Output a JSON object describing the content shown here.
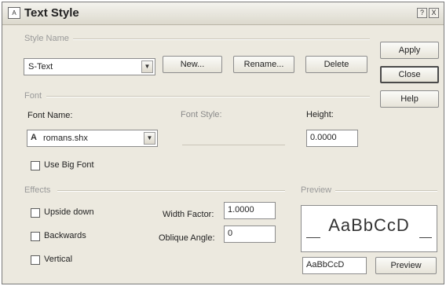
{
  "window": {
    "title": "Text Style",
    "help_glyph": "?",
    "close_glyph": "X"
  },
  "style_name": {
    "group_label": "Style Name",
    "selected": "S-Text",
    "new_label": "New...",
    "rename_label": "Rename...",
    "delete_label": "Delete"
  },
  "side_buttons": {
    "apply": "Apply",
    "close": "Close",
    "help": "Help"
  },
  "font": {
    "group_label": "Font",
    "font_name_label": "Font Name:",
    "font_name_value": "romans.shx",
    "font_style_label": "Font Style:",
    "height_label": "Height:",
    "height_value": "0.0000",
    "big_font_label": "Use Big Font"
  },
  "effects": {
    "group_label": "Effects",
    "upside_down_label": "Upside down",
    "backwards_label": "Backwards",
    "vertical_label": "Vertical",
    "width_factor_label": "Width Factor:",
    "width_factor_value": "1.0000",
    "oblique_angle_label": "Oblique Angle:",
    "oblique_angle_value": "0"
  },
  "preview": {
    "group_label": "Preview",
    "sample_text": "AaBbCcD",
    "input_value": "AaBbCcD",
    "button_label": "Preview"
  },
  "icons": {
    "app_icon": "text-style-icon",
    "font_icon": "shx-font-icon",
    "dropdown": "chevron-down-icon"
  }
}
